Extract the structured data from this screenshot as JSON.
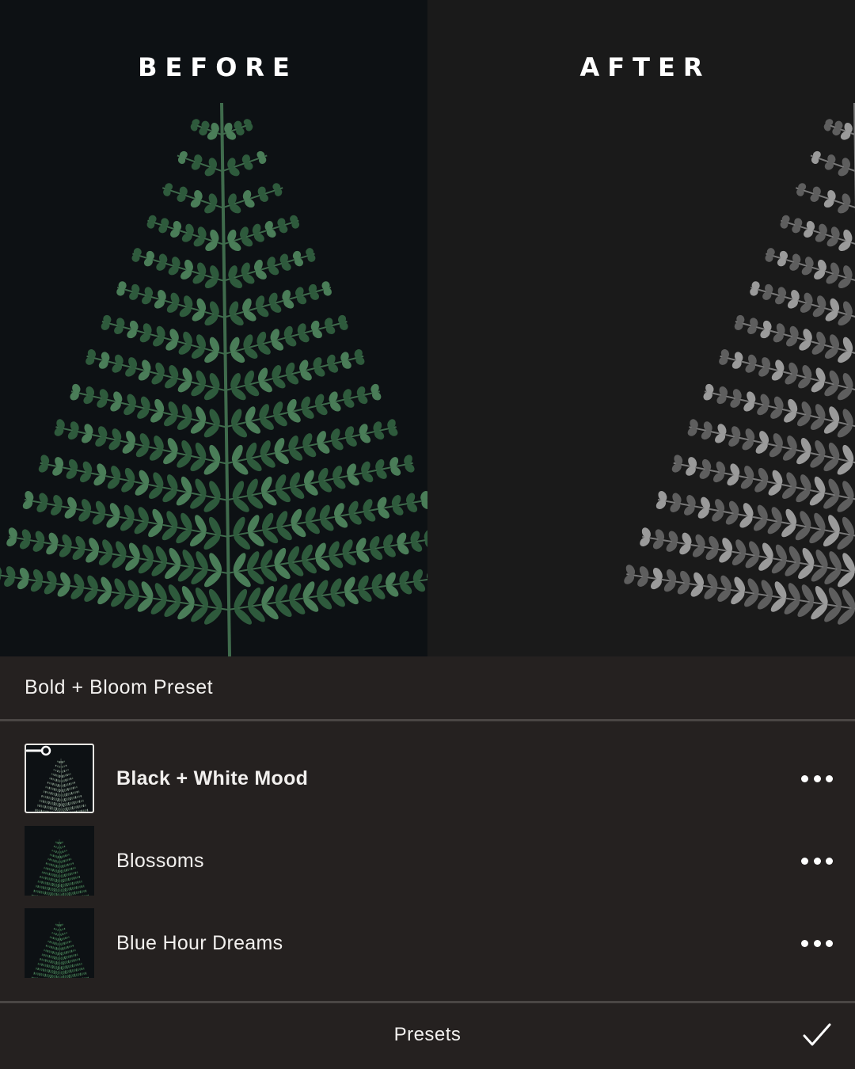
{
  "compare": {
    "before_label": "BEFORE",
    "after_label": "AFTER"
  },
  "preset_pack": {
    "title": "Bold + Bloom Preset"
  },
  "presets": [
    {
      "name": "Black + White Mood",
      "selected": true,
      "thumb_icon": "slider-adjust-icon",
      "menu_icon": "more-horizontal-icon"
    },
    {
      "name": "Blossoms",
      "selected": false,
      "menu_icon": "more-horizontal-icon"
    },
    {
      "name": "Blue Hour Dreams",
      "selected": false,
      "menu_icon": "more-horizontal-icon"
    }
  ],
  "bottom_bar": {
    "title": "Presets",
    "confirm_icon": "checkmark-icon"
  },
  "colors": {
    "background": "#252120",
    "divider": "#4a4644",
    "text": "#f2f0ee",
    "fern_green": "#2e5a3c",
    "fern_gray": "#8a8a8a"
  }
}
